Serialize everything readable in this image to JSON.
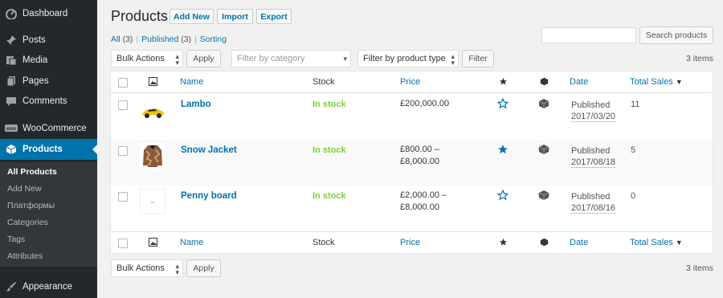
{
  "sidebar": {
    "items": [
      {
        "label": "Dashboard",
        "icon": "dashboard-icon"
      },
      {
        "label": "Posts",
        "icon": "pin-icon"
      },
      {
        "label": "Media",
        "icon": "media-icon"
      },
      {
        "label": "Pages",
        "icon": "pages-icon"
      },
      {
        "label": "Comments",
        "icon": "comment-icon"
      },
      {
        "label": "WooCommerce",
        "icon": "woo-icon"
      },
      {
        "label": "Products",
        "icon": "box-icon"
      },
      {
        "label": "Appearance",
        "icon": "brush-icon"
      }
    ],
    "submenu": [
      "All Products",
      "Add New",
      "Платформы",
      "Categories",
      "Tags",
      "Attributes"
    ]
  },
  "header": {
    "title": "Products",
    "buttons": [
      "Add New",
      "Import",
      "Export"
    ]
  },
  "filters": {
    "all_label": "All",
    "all_count": "(3)",
    "published_label": "Published",
    "published_count": "(3)",
    "sorting_label": "Sorting"
  },
  "search": {
    "button": "Search products",
    "value": ""
  },
  "bulk": {
    "bulk_actions": "Bulk Actions",
    "apply": "Apply",
    "category_placeholder": "Filter by category",
    "type_placeholder": "Filter by product type",
    "filter": "Filter",
    "items_count": "3 items"
  },
  "columns": {
    "name": "Name",
    "stock": "Stock",
    "price": "Price",
    "date": "Date",
    "total_sales": "Total Sales"
  },
  "products": [
    {
      "name": "Lambo",
      "stock": "In stock",
      "price1": "£200,000.00",
      "price2": "",
      "featured": false,
      "status": "Published",
      "date": "2017/03/20",
      "sales": "11"
    },
    {
      "name": "Snow Jacket",
      "stock": "In stock",
      "price1": "£800.00 –",
      "price2": "£8,000.00",
      "featured": true,
      "status": "Published",
      "date": "2017/08/18",
      "sales": "5"
    },
    {
      "name": "Penny board",
      "stock": "In stock",
      "price1": "£2,000.00 –",
      "price2": "£8,000.00",
      "featured": false,
      "status": "Published",
      "date": "2017/08/16",
      "sales": "0"
    }
  ],
  "colors": {
    "accent": "#0073aa",
    "sidebar": "#23282d",
    "instock": "#7ad03a"
  }
}
